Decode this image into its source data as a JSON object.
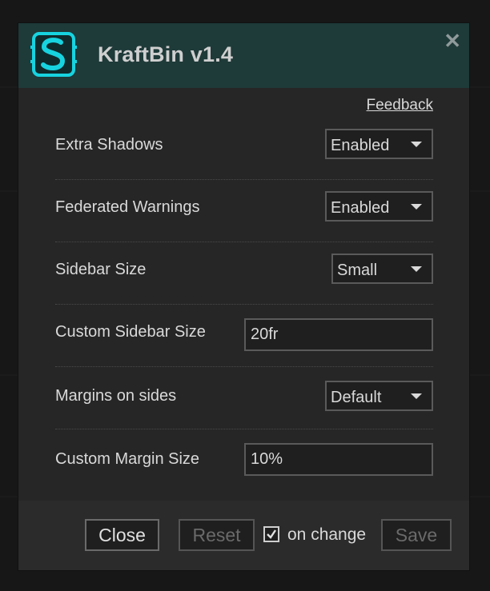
{
  "dialog": {
    "title": "KraftBin v1.4",
    "logo_letter": "S",
    "accent": "#17d3e0",
    "close_glyph": "✕",
    "feedback_label": "Feedback"
  },
  "settings": {
    "extra_shadows": {
      "label": "Extra Shadows",
      "value": "Enabled"
    },
    "federated_warnings": {
      "label": "Federated Warnings",
      "value": "Enabled"
    },
    "sidebar_size": {
      "label": "Sidebar Size",
      "value": "Small"
    },
    "custom_sidebar_size": {
      "label": "Custom Sidebar Size",
      "value": "20fr"
    },
    "margins_on_sides": {
      "label": "Margins on sides",
      "value": "Default"
    },
    "custom_margin_size": {
      "label": "Custom Margin Size",
      "value": "10%"
    }
  },
  "footer": {
    "close_label": "Close",
    "reset_label": "Reset",
    "on_change_label": "on change",
    "on_change_checked": true,
    "save_label": "Save"
  }
}
